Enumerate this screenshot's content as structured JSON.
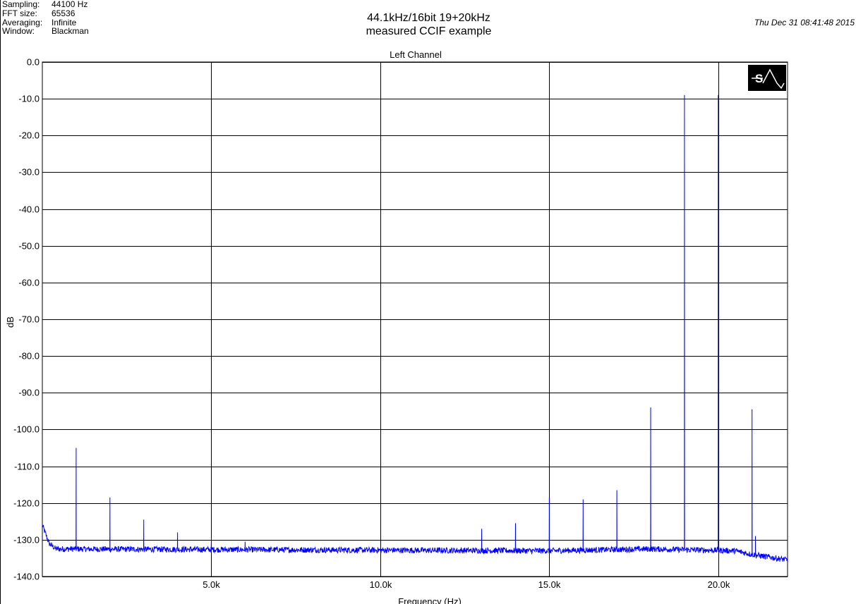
{
  "info": [
    {
      "label": "Sampling:",
      "value": "44100 Hz"
    },
    {
      "label": "FFT size:",
      "value": "65536"
    },
    {
      "label": "Averaging:",
      "value": "Infinite"
    },
    {
      "label": "Window:",
      "value": "Blackman"
    }
  ],
  "title_line1": "44.1kHz/16bit 19+20kHz",
  "title_line2": "measured CCIF example",
  "timestamp": "Thu Dec 31 08:41:48 2015",
  "logo_text": "ST",
  "chart_data": {
    "type": "line",
    "title": "Left Channel",
    "xlabel": "Frequency (Hz)",
    "ylabel": "dB",
    "xlim": [
      0,
      22050
    ],
    "ylim": [
      -140,
      0
    ],
    "grid": true,
    "line_color": "#0000ff",
    "x_ticks": [
      5000,
      10000,
      15000,
      20000
    ],
    "x_tick_labels": [
      "5.0k",
      "10.0k",
      "15.0k",
      "20.0k"
    ],
    "y_ticks": [
      0,
      -10,
      -20,
      -30,
      -40,
      -50,
      -60,
      -70,
      -80,
      -90,
      -100,
      -110,
      -120,
      -130,
      -140
    ],
    "y_tick_labels": [
      "0.0",
      "-10.0",
      "-20.0",
      "-30.0",
      "-40.0",
      "-50.0",
      "-60.0",
      "-70.0",
      "-80.0",
      "-90.0",
      "-100.0",
      "-110.0",
      "-120.0",
      "-130.0",
      "-140.0"
    ],
    "noise_floor": [
      [
        0,
        -126
      ],
      [
        80,
        -128
      ],
      [
        200,
        -131
      ],
      [
        400,
        -132.5
      ],
      [
        15000,
        -133
      ],
      [
        18000,
        -132.5
      ],
      [
        20500,
        -133
      ],
      [
        21000,
        -134
      ],
      [
        22050,
        -135.5
      ]
    ],
    "peaks": [
      {
        "x": 1000,
        "y": -105
      },
      {
        "x": 2000,
        "y": -118.5
      },
      {
        "x": 3000,
        "y": -124.5
      },
      {
        "x": 4000,
        "y": -128
      },
      {
        "x": 5000,
        "y": -129.5
      },
      {
        "x": 6000,
        "y": -130.5
      },
      {
        "x": 13000,
        "y": -127
      },
      {
        "x": 14000,
        "y": -125.5
      },
      {
        "x": 15000,
        "y": -118.5
      },
      {
        "x": 16000,
        "y": -119
      },
      {
        "x": 17000,
        "y": -116.5
      },
      {
        "x": 18000,
        "y": -94
      },
      {
        "x": 19000,
        "y": -9
      },
      {
        "x": 20000,
        "y": -9
      },
      {
        "x": 21000,
        "y": -94.5
      },
      {
        "x": 21100,
        "y": -129
      }
    ]
  }
}
